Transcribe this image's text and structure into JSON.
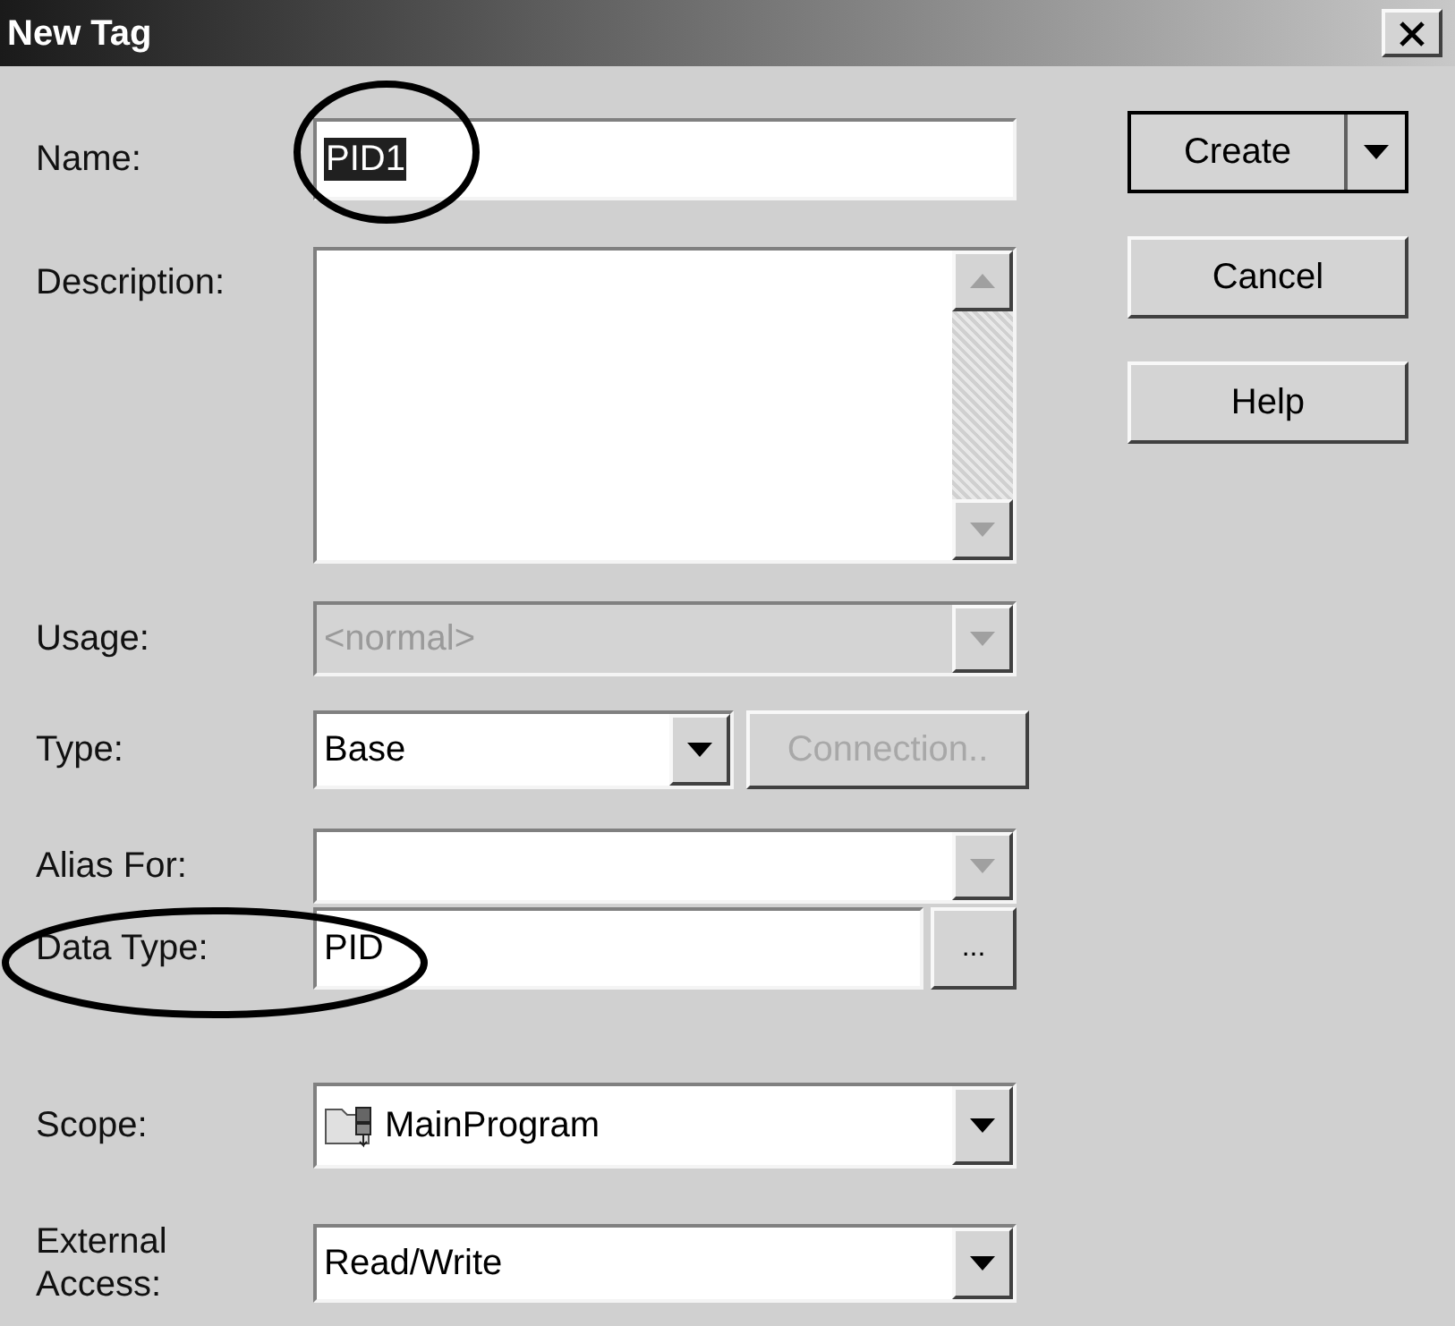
{
  "window": {
    "title": "New Tag"
  },
  "fields": [
    {
      "kind": "text",
      "label": "Name:",
      "value": "PID1",
      "selected": true
    },
    {
      "kind": "textarea",
      "label": "Description:"
    },
    {
      "kind": "combo",
      "label": "Usage:",
      "value": "<normal>",
      "disabled": true,
      "arrow_disabled": true
    },
    {
      "kind": "combo",
      "label": "Type:",
      "value": "Base",
      "disabled": false,
      "arrow_disabled": false,
      "button": {
        "label": "Connection..",
        "disabled": true
      }
    },
    {
      "kind": "combo",
      "label": "Alias For:",
      "disabled": false,
      "arrow_disabled": true
    },
    {
      "kind": "browse",
      "label": "Data Type:",
      "value": "PID",
      "button": {
        "label": "...",
        "disabled": false
      }
    },
    {
      "kind": "combo",
      "label": "Scope:",
      "value": "MainProgram",
      "disabled": false,
      "arrow_disabled": false,
      "has_icon": true
    },
    {
      "kind": "combo",
      "label": "External Access:",
      "value": "Read/Write",
      "disabled": false,
      "arrow_disabled": false
    }
  ],
  "buttons": [
    {
      "label": "Create",
      "default": true,
      "split": true
    },
    {
      "label": "Cancel",
      "default": false,
      "split": false
    },
    {
      "label": "Help",
      "default": false,
      "split": false
    }
  ]
}
